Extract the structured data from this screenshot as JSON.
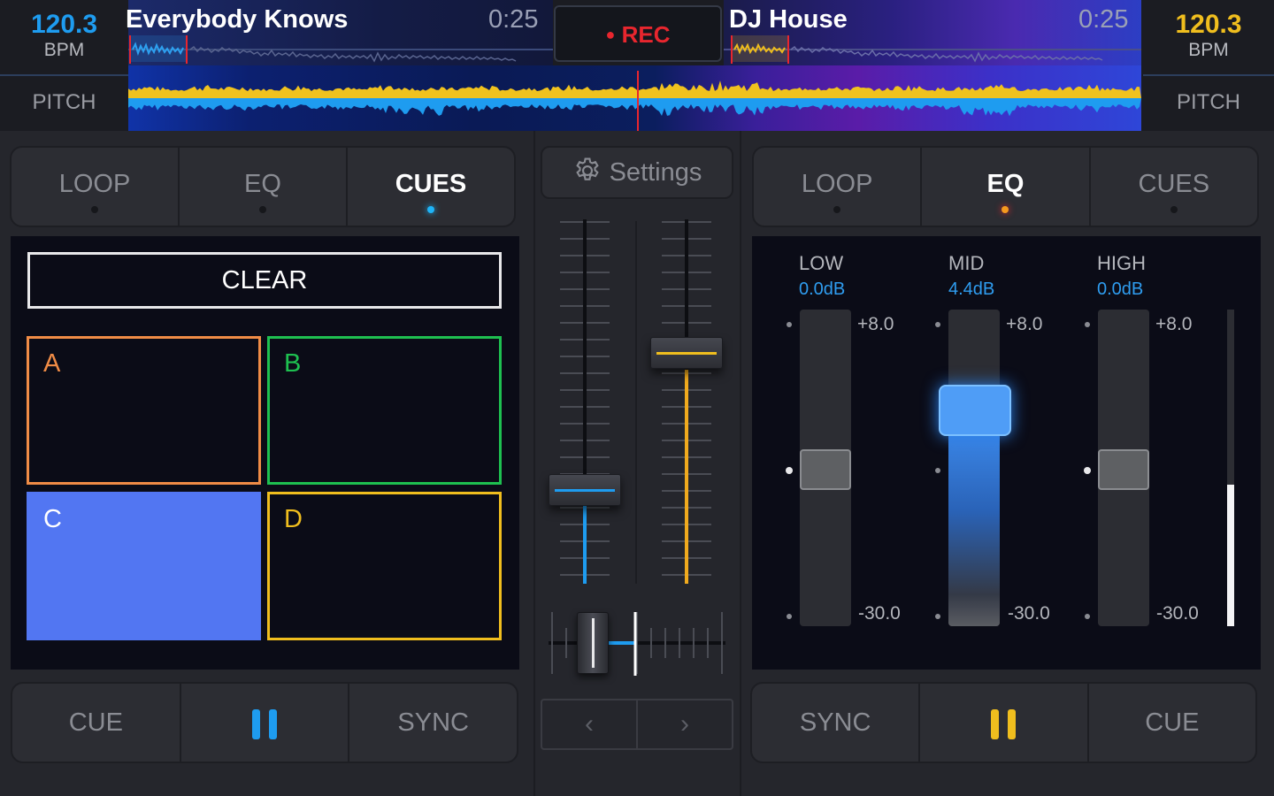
{
  "deck_a": {
    "bpm": "120.3",
    "bpm_label": "BPM",
    "pitch_label": "PITCH",
    "title": "Everybody Knows",
    "time": "0:25",
    "accent": "#1e9cf0",
    "tabs": [
      "LOOP",
      "EQ",
      "CUES"
    ],
    "active_tab": "CUES",
    "clear_label": "CLEAR",
    "pads": [
      {
        "label": "A",
        "color": "#f08c46"
      },
      {
        "label": "B",
        "color": "#1ec050"
      },
      {
        "label": "C",
        "color": "#5276f2"
      },
      {
        "label": "D",
        "color": "#f0be1e"
      }
    ],
    "buttons": {
      "cue": "CUE",
      "sync": "SYNC"
    }
  },
  "deck_b": {
    "bpm": "120.3",
    "bpm_label": "BPM",
    "pitch_label": "PITCH",
    "title": "DJ House",
    "time": "0:25",
    "accent": "#f0be1e",
    "tabs": [
      "LOOP",
      "EQ",
      "CUES"
    ],
    "active_tab": "EQ",
    "eq": [
      {
        "name": "LOW",
        "value": "0.0dB",
        "max": "+8.0",
        "min": "-30.0"
      },
      {
        "name": "MID",
        "value": "4.4dB",
        "max": "+8.0",
        "min": "-30.0"
      },
      {
        "name": "HIGH",
        "value": "0.0dB",
        "max": "+8.0",
        "min": "-30.0"
      }
    ],
    "buttons": {
      "sync": "SYNC",
      "cue": "CUE"
    }
  },
  "mixer": {
    "rec_label": "REC",
    "settings_label": "Settings",
    "nav_prev": "‹",
    "nav_next": "›",
    "rec_color": "#e8262e"
  }
}
